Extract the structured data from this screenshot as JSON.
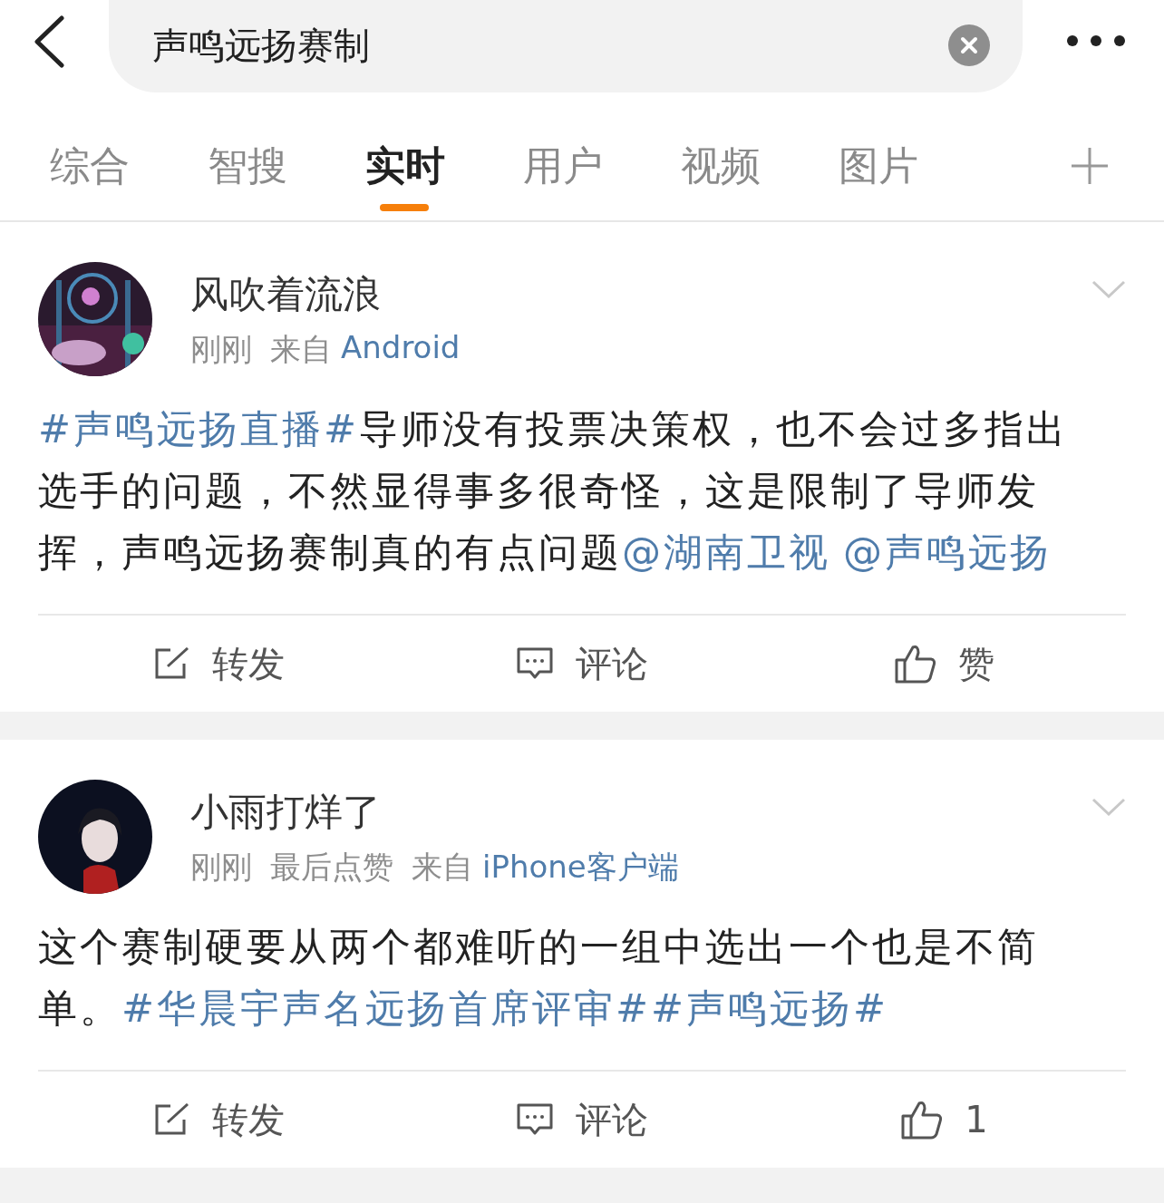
{
  "search": {
    "value": "声鸣远扬赛制"
  },
  "tabs": [
    {
      "label": "综合",
      "selected": false
    },
    {
      "label": "智搜",
      "selected": false
    },
    {
      "label": "实时",
      "selected": true
    },
    {
      "label": "用户",
      "selected": false
    },
    {
      "label": "视频",
      "selected": false
    },
    {
      "label": "图片",
      "selected": false
    }
  ],
  "posts": [
    {
      "author": "风吹着流浪",
      "avatar": {
        "kind": "picture"
      },
      "meta": [
        {
          "kind": "plain",
          "text": "刚刚"
        },
        {
          "kind": "plain",
          "text": "来自"
        },
        {
          "kind": "link",
          "text": "Android"
        }
      ],
      "body": [
        {
          "kind": "topic",
          "text": "#声鸣远扬直播#"
        },
        {
          "kind": "text",
          "text": "导师没有投票决策权，也不会过多指出选手的问题，不然显得事多很奇怪，这是限制了导师发挥，声鸣远扬赛制真的有点问题"
        },
        {
          "kind": "mention",
          "text": "@湖南卫视"
        },
        {
          "kind": "mention",
          "text": "@声鸣远扬"
        }
      ],
      "actions": [
        {
          "kind": "repost",
          "label": "转发"
        },
        {
          "kind": "comment",
          "label": "评论"
        },
        {
          "kind": "like",
          "label": "赞"
        }
      ]
    },
    {
      "author": "小雨打烊了",
      "avatar": {
        "kind": "picture"
      },
      "meta": [
        {
          "kind": "plain",
          "text": "刚刚"
        },
        {
          "kind": "plain",
          "text": "最后点赞"
        },
        {
          "kind": "plain",
          "text": "来自"
        },
        {
          "kind": "link",
          "text": "iPhone客户端"
        }
      ],
      "body": [
        {
          "kind": "text",
          "text": "这个赛制硬要从两个都难听的一组中选出一个也是不简单。"
        },
        {
          "kind": "topic",
          "text": "#华晨宇声名远扬首席评审#"
        },
        {
          "kind": "topic",
          "text": "#声鸣远扬#"
        }
      ],
      "actions": [
        {
          "kind": "repost",
          "label": "转发"
        },
        {
          "kind": "comment",
          "label": "评论"
        },
        {
          "kind": "like",
          "label": "1"
        }
      ]
    }
  ]
}
